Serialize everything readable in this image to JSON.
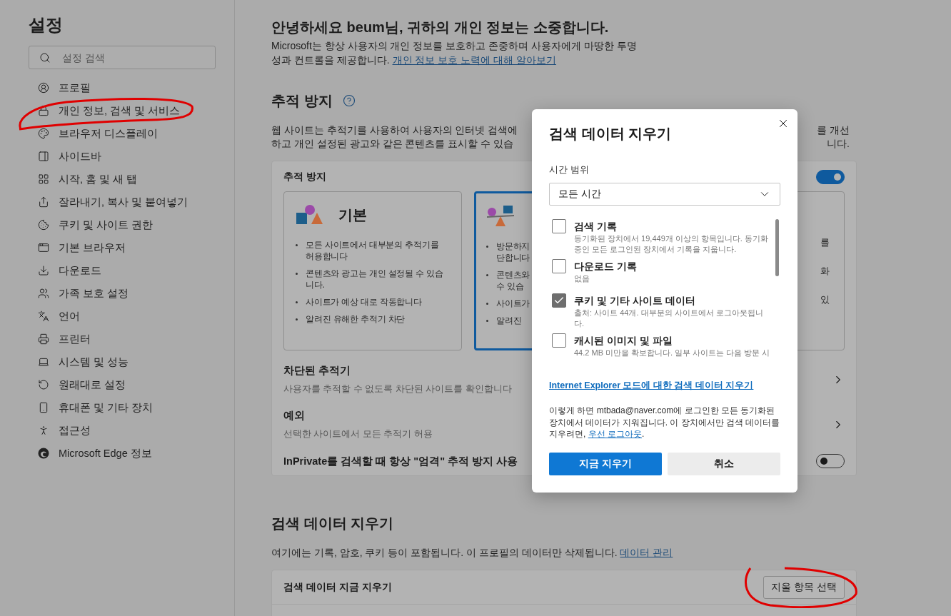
{
  "sidebar": {
    "title": "설정",
    "search": {
      "placeholder": "설정 검색"
    },
    "items": [
      {
        "label": "프로필",
        "circled": false
      },
      {
        "label": "개인 정보, 검색 및 서비스",
        "circled": true
      },
      {
        "label": "브라우저 디스플레이",
        "circled": false
      },
      {
        "label": "사이드바",
        "circled": false
      },
      {
        "label": "시작, 홈 및 새 탭",
        "circled": false
      },
      {
        "label": "잘라내기, 복사 및 붙여넣기",
        "circled": false
      },
      {
        "label": "쿠키 및 사이트 권한",
        "circled": false
      },
      {
        "label": "기본 브라우저",
        "circled": false
      },
      {
        "label": "다운로드",
        "circled": false
      },
      {
        "label": "가족 보호 설정",
        "circled": false
      },
      {
        "label": "언어",
        "circled": false
      },
      {
        "label": "프린터",
        "circled": false
      },
      {
        "label": "시스템 및 성능",
        "circled": false
      },
      {
        "label": "원래대로 설정",
        "circled": false
      },
      {
        "label": "휴대폰 및 기타 장치",
        "circled": false
      },
      {
        "label": "접근성",
        "circled": false
      },
      {
        "label": "Microsoft Edge 정보",
        "circled": false
      }
    ]
  },
  "greeting": {
    "title": "안녕하세요 beum님, 귀하의 개인 정보는 소중합니다.",
    "text": "Microsoft는 항상 사용자의 개인 정보를 보호하고 존중하며 사용자에게 마땅한 투명성과 컨트롤을 제공합니다. ",
    "link": "개인 정보 보호 노력에 대해 알아보기"
  },
  "tracking": {
    "title": "추적 방지",
    "description_left": [
      "웹 사이트는 추적기를 사용하여 사용자의 인터넷 검색에",
      "하고 개인 설정된 광고와 같은 콘텐츠를 표시할 수 있습"
    ],
    "description_right": [
      "를 개선",
      "니다."
    ],
    "card": {
      "title": "추적 방지",
      "on": true,
      "options": [
        {
          "kind": "basic",
          "title": "기본",
          "selected": false,
          "bullets": [
            [
              "모든 사이트에서 대부분의 추적기를",
              "허용합니다"
            ],
            [
              "콘텐츠와 광고는 개인 설정될 수 있습",
              "니다."
            ],
            [
              "사이트가 예상 대로 작동합니다"
            ],
            [
              "알려진 유해한 추적기 차단"
            ]
          ]
        },
        {
          "kind": "balanced",
          "selected": true,
          "bullets": [
            [
              "방문하지",
              "단합니다"
            ],
            [
              "콘텐츠와",
              "수 있습"
            ],
            [
              "사이트가"
            ],
            [
              "알려진"
            ]
          ]
        },
        {
          "kind": "strict",
          "selected": false,
          "fragments": [
            "를",
            "화",
            "있"
          ]
        }
      ],
      "rows": [
        {
          "kind": "link",
          "title": "차단된 추적기",
          "description": "사용자를 추적할 수 없도록 차단된 사이트를 확인합니다"
        },
        {
          "kind": "link",
          "title": "예외",
          "description": "선택한 사이트에서 모든 추적기 허용"
        },
        {
          "kind": "toggle",
          "title": "InPrivate를 검색할 때 항상 \"엄격\" 추적 방지 사용",
          "on": false
        }
      ]
    }
  },
  "clear": {
    "title": "검색 데이터 지우기",
    "text": "여기에는 기록, 암호, 쿠키 등이 포함됩니다. 이 프로필의 데이터만 삭제됩니다. ",
    "link": "데이터 관리",
    "row": {
      "label": "검색 데이터 지금 지우기",
      "button": "지울 항목 선택",
      "circled": true
    }
  },
  "dialog": {
    "title": "검색 데이터 지우기",
    "range_label": "시간 범위",
    "range_value": "모든 시간",
    "items": [
      {
        "title": "검색 기록",
        "description": "동기화된 장치에서 19,449개 이상의 항목입니다. 동기화 중인 모든 로그인된 장치에서 기록을 지웁니다.",
        "checked": false
      },
      {
        "title": "다운로드 기록",
        "description": "없음",
        "checked": false
      },
      {
        "title": "쿠키 및 기타 사이트 데이터",
        "description": "출처: 사이트 44개. 대부분의 사이트에서 로그아웃됩니다.",
        "checked": true
      },
      {
        "title": "캐시된 이미지 및 파일",
        "description": "44.2 MB 미만을 확보합니다. 일부 사이트는 다음 방문 시",
        "checked": false
      }
    ],
    "ie_link": "Internet Explorer 모드에 대한 검색 데이터 지우기",
    "notice": {
      "before": "이렇게 하면 mtbada@naver.com에 로그인한 모든 동기화된 장치에서 데이터가 지워집니다. 이 장치에서만 검색 데이터를 지우려면, ",
      "link": "우선 로그아웃",
      "after": "."
    },
    "buttons": [
      {
        "label": "지금 지우기",
        "kind": "primary"
      },
      {
        "label": "취소",
        "kind": "secondary"
      }
    ]
  }
}
